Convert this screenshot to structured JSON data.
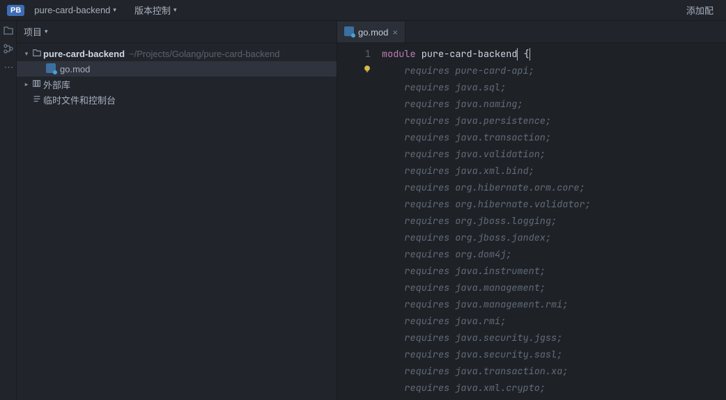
{
  "topbar": {
    "project_label": "pure-card-backend",
    "badge": "PB",
    "vcs_label": "版本控制",
    "right_action": "添加配"
  },
  "sidebar": {
    "title": "项目",
    "tree": {
      "root": {
        "label": "pure-card-backend",
        "path": "~/Projects/Golang/pure-card-backend"
      },
      "go_mod": "go.mod",
      "external_lib": "外部库",
      "scratches": "临时文件和控制台"
    }
  },
  "tabs": {
    "active": "go.mod"
  },
  "editor": {
    "line_number": "1",
    "module_keyword": "module",
    "module_name": "pure-card-backend",
    "brace": " {",
    "requires_keyword": "requires",
    "hints": [
      "pure-card-api;",
      "java.sql;",
      "java.naming;",
      "java.persistence;",
      "java.transaction;",
      "java.validation;",
      "java.xml.bind;",
      "org.hibernate.orm.core;",
      "org.hibernate.validator;",
      "org.jboss.logging;",
      "org.jboss.jandex;",
      "org.dom4j;",
      "java.instrument;",
      "java.management;",
      "java.management.rmi;",
      "java.rmi;",
      "java.security.jgss;",
      "java.security.sasl;",
      "java.transaction.xa;",
      "java.xml.crypto;"
    ]
  }
}
